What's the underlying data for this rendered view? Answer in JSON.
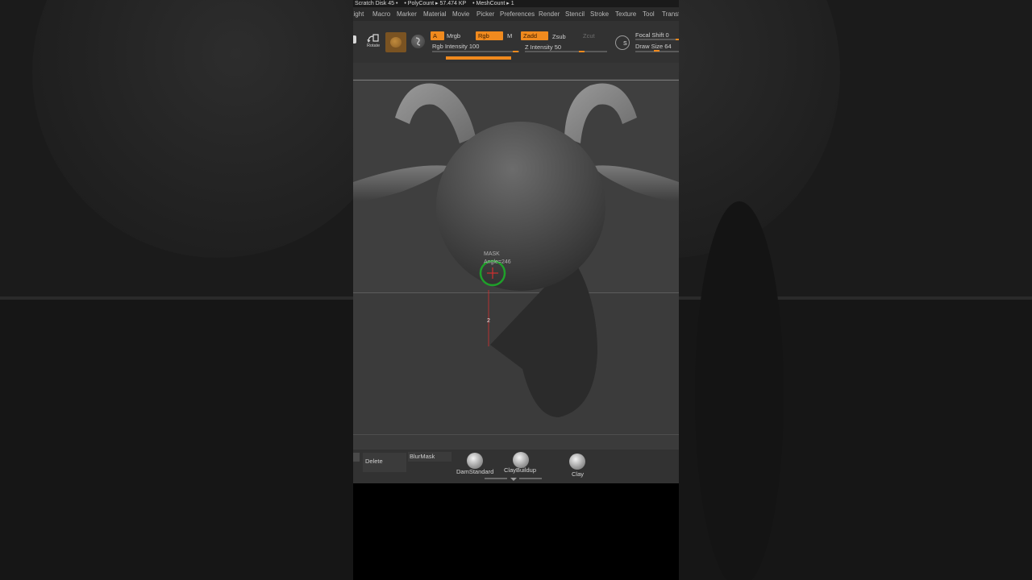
{
  "statusbar": {
    "scratch_disk": "Scratch Disk 45 •",
    "poly_count": "• PolyCount ▸ 57.474 KP",
    "mesh_count": "• MeshCount ▸ 1"
  },
  "menu": {
    "items": [
      "Light",
      "Macro",
      "Marker",
      "Material",
      "Movie",
      "Picker",
      "Preferences",
      "Render",
      "Stencil",
      "Stroke",
      "Texture",
      "Tool",
      "Transf"
    ]
  },
  "toolbar": {
    "rotate_label": "Rotate",
    "a_label": "A",
    "mrgb_label": "Mrgb",
    "rgb_label": "Rgb",
    "m_label": "M",
    "zadd_label": "Zadd",
    "zsub_label": "Zsub",
    "zcut_label": "Zcut",
    "rgb_intensity_label": "Rgb Intensity",
    "rgb_intensity_value": "100",
    "z_intensity_label": "Z Intensity",
    "z_intensity_value": "50",
    "focal_shift_label": "Focal Shift",
    "focal_shift_value": "0",
    "draw_size_label": "Draw Size",
    "draw_size_value": "64",
    "s_label": "S"
  },
  "viewport": {
    "mask_label": "MASK",
    "angle_label": "Angle=246",
    "length_marker": "2"
  },
  "shelf": {
    "delete_label": "Delete",
    "blurmask_label": "BlurMask",
    "brushes": [
      "DamStandard",
      "ClayBuildup",
      "Clay"
    ]
  },
  "colors": {
    "accent": "#f08a1e",
    "cursor_ring": "#1fa02a",
    "cursor_cross": "#d23030"
  }
}
